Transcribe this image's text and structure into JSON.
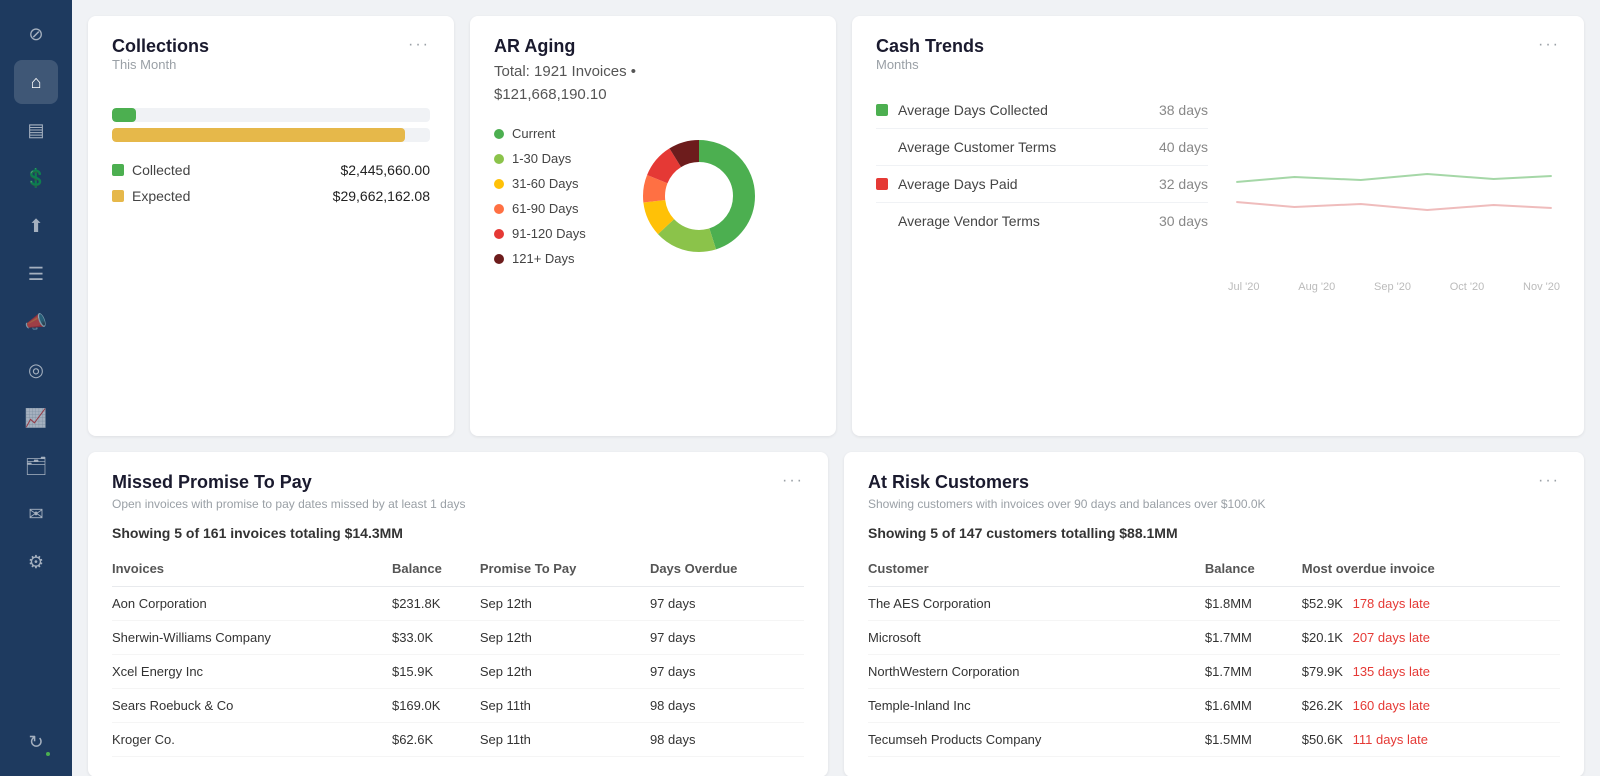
{
  "sidebar": {
    "icons": [
      {
        "name": "compass-icon",
        "symbol": "⊘",
        "active": false
      },
      {
        "name": "home-icon",
        "symbol": "⌂",
        "active": true
      },
      {
        "name": "chart-icon",
        "symbol": "▦",
        "active": false
      },
      {
        "name": "dollar-icon",
        "symbol": "$",
        "active": false
      },
      {
        "name": "upload-icon",
        "symbol": "↑",
        "active": false
      },
      {
        "name": "list-icon",
        "symbol": "☰",
        "active": false
      },
      {
        "name": "megaphone-icon",
        "symbol": "📣",
        "active": false
      },
      {
        "name": "target-icon",
        "symbol": "◎",
        "active": false
      },
      {
        "name": "chart2-icon",
        "symbol": "📊",
        "active": false
      },
      {
        "name": "folder-icon",
        "symbol": "🗂",
        "active": false
      },
      {
        "name": "mail-icon",
        "symbol": "✉",
        "active": false
      },
      {
        "name": "gear-icon",
        "symbol": "⚙",
        "active": false
      },
      {
        "name": "sync-icon",
        "symbol": "↻",
        "active": false,
        "has_dot": true
      }
    ]
  },
  "collections": {
    "title": "Collections",
    "subtitle": "This Month",
    "menu": "···",
    "collected_bar_pct": 7.6,
    "expected_bar_pct": 92,
    "collected_color": "#4caf50",
    "expected_color": "#e6b84a",
    "legend": [
      {
        "label": "Collected",
        "value": "$2,445,660.00",
        "color": "#4caf50"
      },
      {
        "label": "Expected",
        "value": "$29,662,162.08",
        "color": "#e6b84a"
      }
    ]
  },
  "ar_aging": {
    "title": "AR Aging",
    "total_text": "Total: 1921 Invoices •\n$121,668,190.10",
    "legend": [
      {
        "label": "Current",
        "color": "#4caf50"
      },
      {
        "label": "1-30 Days",
        "color": "#8bc34a"
      },
      {
        "label": "31-60 Days",
        "color": "#ffc107"
      },
      {
        "label": "61-90 Days",
        "color": "#ff7043"
      },
      {
        "label": "91-120 Days",
        "color": "#e53935"
      },
      {
        "label": "121+ Days",
        "color": "#6d1c1c"
      }
    ],
    "donut_segments": [
      {
        "color": "#4caf50",
        "pct": 45
      },
      {
        "color": "#8bc34a",
        "pct": 18
      },
      {
        "color": "#ffc107",
        "pct": 10
      },
      {
        "color": "#ff7043",
        "pct": 8
      },
      {
        "color": "#e53935",
        "pct": 10
      },
      {
        "color": "#6d1c1c",
        "pct": 9
      }
    ]
  },
  "cash_trends": {
    "title": "Cash Trends",
    "subtitle": "Months",
    "menu": "···",
    "metrics": [
      {
        "label": "Average Days Collected",
        "value": "38 days",
        "color": "#4caf50",
        "has_indicator": true
      },
      {
        "label": "Average Customer Terms",
        "value": "40 days",
        "color": "transparent",
        "has_indicator": false
      },
      {
        "label": "Average Days Paid",
        "value": "32 days",
        "color": "#e53935",
        "has_indicator": true
      },
      {
        "label": "Average Vendor Terms",
        "value": "30 days",
        "color": "transparent",
        "has_indicator": false
      }
    ],
    "x_labels": [
      "Jul '20",
      "Aug '20",
      "Sep '20",
      "Oct '20",
      "Nov '20"
    ]
  },
  "missed_promise": {
    "title": "Missed Promise To Pay",
    "menu": "···",
    "description": "Open invoices with promise to pay dates missed by at least 1 days",
    "summary": "Showing 5 of 161 invoices totaling $14.3MM",
    "columns": [
      "Invoices",
      "Balance",
      "Promise To Pay",
      "Days Overdue"
    ],
    "rows": [
      {
        "invoice": "Aon Corporation",
        "balance": "$231.8K",
        "promise": "Sep 12th",
        "days": "97 days"
      },
      {
        "invoice": "Sherwin-Williams Company",
        "balance": "$33.0K",
        "promise": "Sep 12th",
        "days": "97 days"
      },
      {
        "invoice": "Xcel Energy Inc",
        "balance": "$15.9K",
        "promise": "Sep 12th",
        "days": "97 days"
      },
      {
        "invoice": "Sears Roebuck & Co",
        "balance": "$169.0K",
        "promise": "Sep 11th",
        "days": "98 days"
      },
      {
        "invoice": "Kroger Co.",
        "balance": "$62.6K",
        "promise": "Sep 11th",
        "days": "98 days"
      }
    ]
  },
  "at_risk": {
    "title": "At Risk Customers",
    "menu": "···",
    "description": "Showing customers with invoices over 90 days and balances over $100.0K",
    "summary": "Showing 5 of 147 customers totalling $88.1MM",
    "columns": [
      "Customer",
      "Balance",
      "Most overdue invoice"
    ],
    "rows": [
      {
        "customer": "The AES Corporation",
        "balance": "$1.8MM",
        "invoice": "$52.9K",
        "days": "178 days late"
      },
      {
        "customer": "Microsoft",
        "balance": "$1.7MM",
        "invoice": "$20.1K",
        "days": "207 days late"
      },
      {
        "customer": "NorthWestern Corporation",
        "balance": "$1.7MM",
        "invoice": "$79.9K",
        "days": "135 days late"
      },
      {
        "customer": "Temple-Inland Inc",
        "balance": "$1.6MM",
        "invoice": "$26.2K",
        "days": "160 days late"
      },
      {
        "customer": "Tecumseh Products Company",
        "balance": "$1.5MM",
        "invoice": "$50.6K",
        "days": "111 days late"
      }
    ]
  }
}
